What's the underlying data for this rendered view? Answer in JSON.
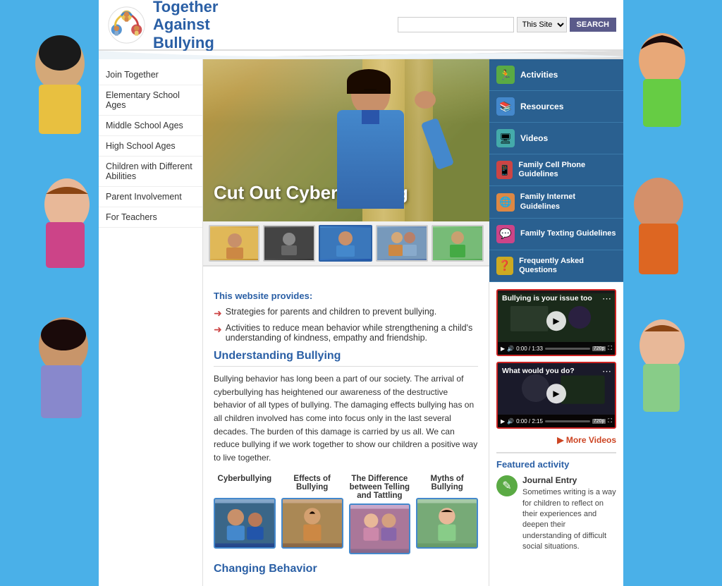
{
  "site": {
    "title": "Together Against Bullying",
    "title_line1": "Together",
    "title_line2": "Against",
    "title_line3": "Bullying"
  },
  "header": {
    "search_placeholder": "",
    "search_scope": "This Site",
    "search_button": "SEARCH"
  },
  "nav": {
    "items": [
      {
        "label": "Join Together",
        "href": "#"
      },
      {
        "label": "Elementary School Ages",
        "href": "#"
      },
      {
        "label": "Middle School Ages",
        "href": "#"
      },
      {
        "label": "High School Ages",
        "href": "#"
      },
      {
        "label": "Children with Different Abilities",
        "href": "#"
      },
      {
        "label": "Parent Involvement",
        "href": "#"
      },
      {
        "label": "For Teachers",
        "href": "#"
      }
    ]
  },
  "hero": {
    "slide_title": "Cut Out Cyberbullying"
  },
  "right_nav": {
    "items": [
      {
        "icon": "🏃",
        "icon_class": "green",
        "label": "Activities"
      },
      {
        "icon": "📚",
        "icon_class": "blue",
        "label": "Resources"
      },
      {
        "icon": "🖥",
        "icon_class": "teal",
        "label": "Videos"
      },
      {
        "icon": "📱",
        "icon_class": "red",
        "label": "Family Cell Phone Guidelines"
      },
      {
        "icon": "🌐",
        "icon_class": "orange",
        "label": "Family Internet Guidelines"
      },
      {
        "icon": "💬",
        "icon_class": "pink",
        "label": "Family Texting Guidelines"
      },
      {
        "icon": "❓",
        "icon_class": "yellow",
        "label": "Frequently Asked Questions"
      }
    ]
  },
  "main": {
    "provides_title": "This website provides:",
    "bullets": [
      "Strategies for parents and children to prevent bullying.",
      "Activities to reduce mean behavior while strengthening a child's understanding of kindness, empathy and friendship."
    ],
    "understanding_title": "Understanding Bullying",
    "understanding_text": "Bullying behavior has long been a part of our society. The arrival of cyberbullying has heightened our awareness of the destructive behavior of all types of bullying. The damaging effects bullying has on all children involved has come into focus only in the last several decades. The burden of this damage is carried by us all. We can reduce bullying if we work together to show our children a positive way to live together.",
    "cards": [
      {
        "title": "Cyberbullying",
        "bg": "cyber"
      },
      {
        "title": "Effects of Bullying",
        "bg": "effects"
      },
      {
        "title": "The Difference between Telling and Tattling",
        "bg": "telling"
      },
      {
        "title": "Myths of Bullying",
        "bg": "myths"
      }
    ],
    "changing_behavior": "Changing Behavior"
  },
  "videos": [
    {
      "title": "Bullying is your issue too",
      "time": "0:00 / 1:33"
    },
    {
      "title": "What would you do?",
      "time": "0:00 / 2:15"
    }
  ],
  "more_videos_label": "More Videos",
  "featured": {
    "section_title": "Featured activity",
    "icon": "✎",
    "item_title": "Journal Entry",
    "item_text": "Sometimes writing is a way for children to reflect on their experiences and deepen their understanding of difficult social situations."
  }
}
